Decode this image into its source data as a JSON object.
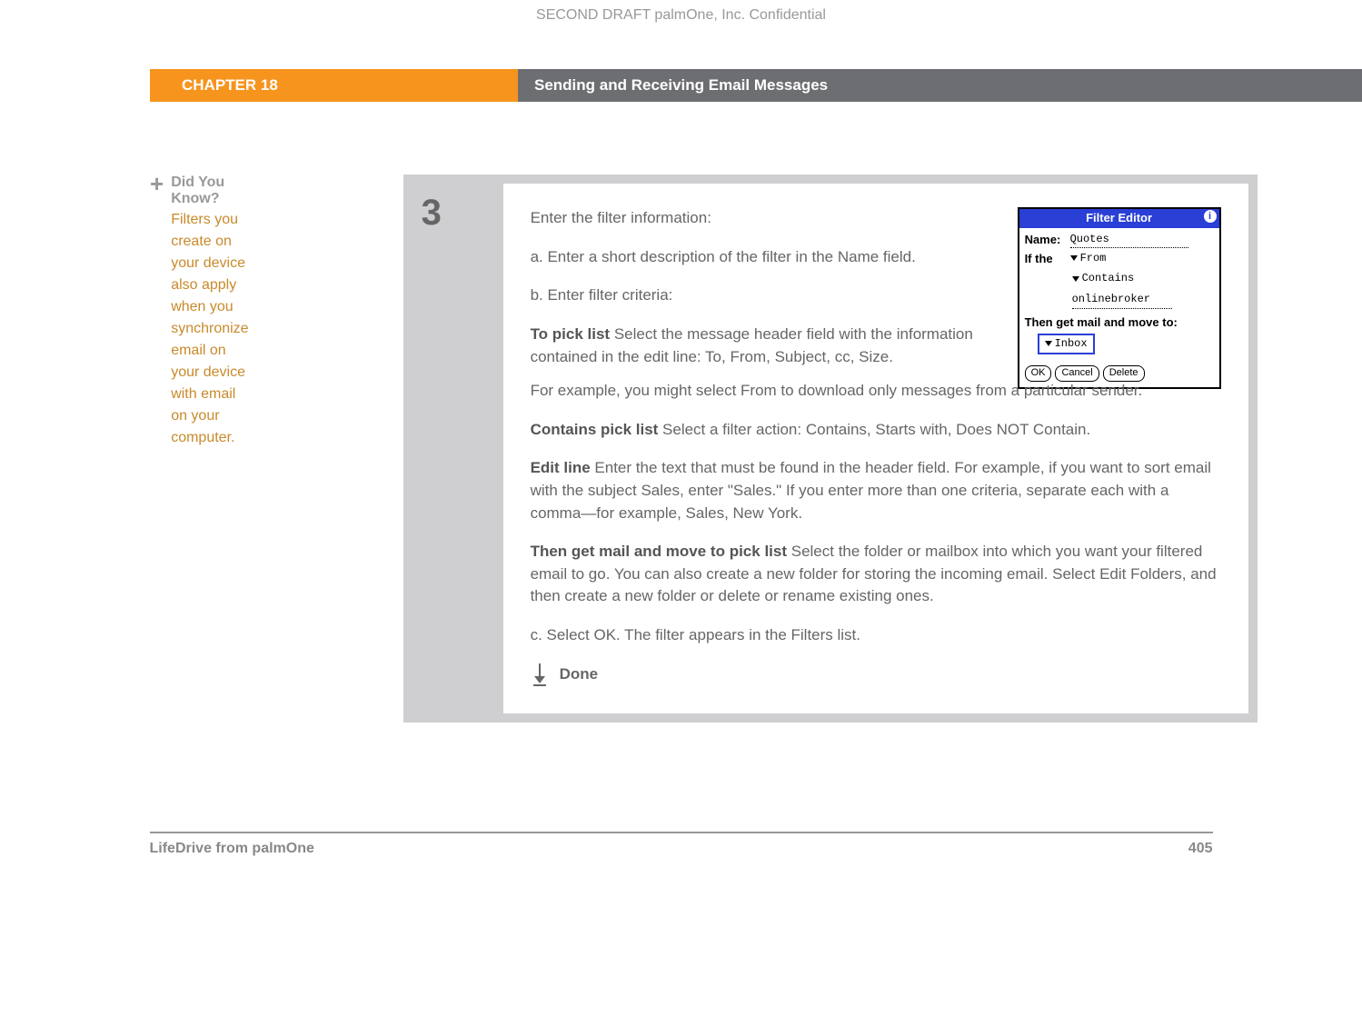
{
  "confidential": "SECOND DRAFT palmOne, Inc.  Confidential",
  "header": {
    "chapter": "CHAPTER 18",
    "title": "Sending and Receiving Email Messages"
  },
  "sidebar": {
    "dyk_title": "Did You Know?",
    "dyk_text": "Filters you create on your device also apply when you synchronize email on your device with email on your computer."
  },
  "step": {
    "number": "3",
    "intro": "Enter the filter information:",
    "a": "a.  Enter a short description of the filter in the Name field.",
    "b": "b.  Enter filter criteria:",
    "to_pick_label": "To pick list",
    "to_pick_text": "   Select the message header field with the information contained in the edit line: To, From, Subject, cc, Size.",
    "to_pick_cont": "For example, you might select From to download only messages from a particular sender.",
    "contains_label": "Contains pick list",
    "contains_text": "   Select a filter action: Contains, Starts with, Does NOT Contain.",
    "edit_label": "Edit line",
    "edit_text": "   Enter the text that must be found in the header field. For example, if you want to sort email with the subject Sales, enter \"Sales.\" If you enter more than one criteria, separate each with a comma—for example, Sales, New York.",
    "then_label": "Then get mail and move to pick list",
    "then_text": "   Select the folder or mailbox into which you want your filtered email to go. You can also create a new folder for storing the incoming email. Select Edit Folders, and then create a new folder or delete or rename existing ones.",
    "c": "c.  Select OK. The filter appears in the Filters list.",
    "done": "Done"
  },
  "filter_editor": {
    "title": "Filter Editor",
    "name_label": "Name:",
    "name_value": "Quotes",
    "if_label": "If the",
    "from": "From",
    "contains": "Contains",
    "value": "onlinebroker",
    "then_label": "Then get mail and move to:",
    "inbox": "Inbox",
    "ok": "OK",
    "cancel": "Cancel",
    "delete": "Delete"
  },
  "footer": {
    "product": "LifeDrive from palmOne",
    "page": "405"
  }
}
